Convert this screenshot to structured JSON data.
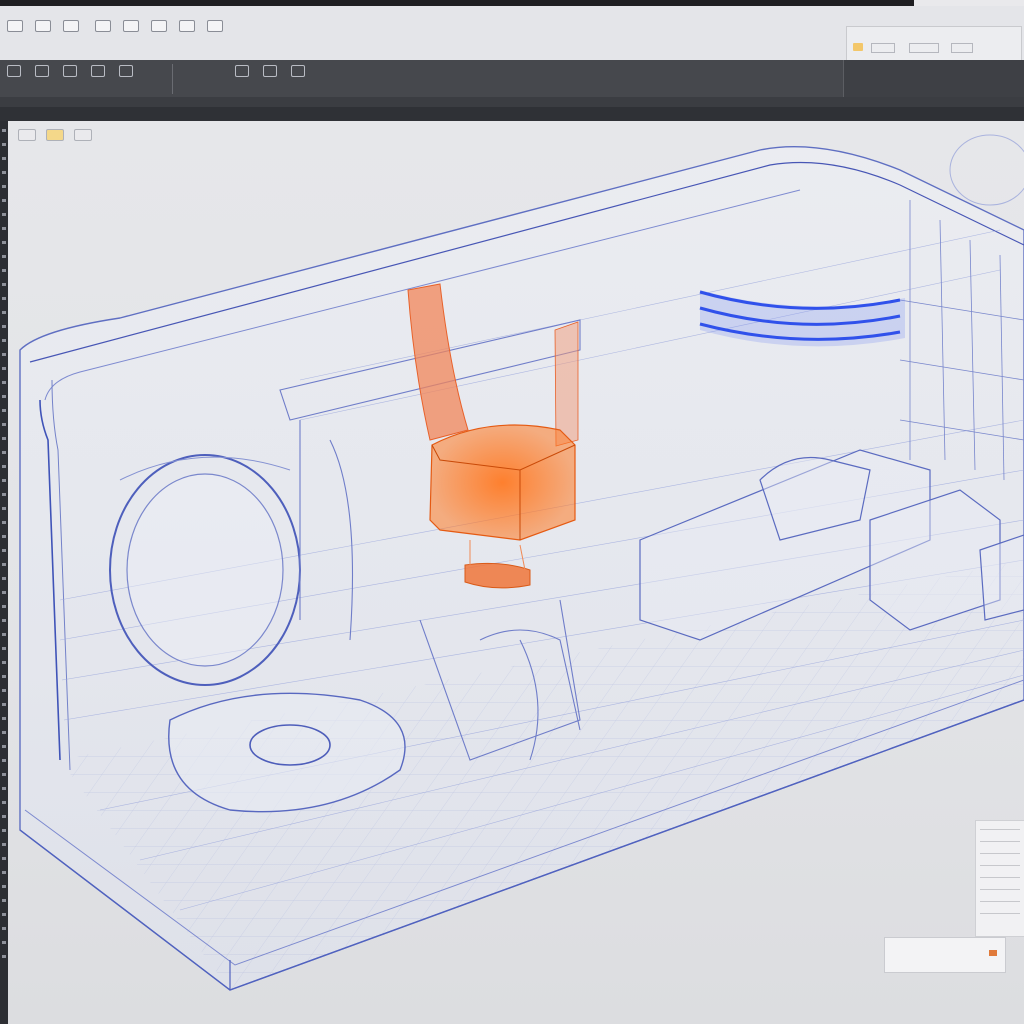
{
  "window": {
    "app_title": "",
    "quick_access": {
      "items": [
        "",
        "",
        "",
        "",
        "",
        "",
        "",
        ""
      ],
      "right_panel": {
        "label_a": "",
        "label_b": "",
        "label_c": ""
      }
    },
    "ribbon": {
      "left_texts": [
        "",
        ""
      ],
      "right_text": "",
      "buttons": [
        "",
        "",
        "",
        "",
        "",
        "",
        "",
        ""
      ]
    },
    "tabs": [
      "",
      "",
      "",
      "",
      "",
      "",
      "",
      "",
      ""
    ],
    "status_row": {
      "left": "",
      "middle": ""
    }
  },
  "viewport": {
    "mini_toolbar": [
      "",
      ""
    ],
    "colors": {
      "wireframe": "#3f53b8",
      "highlight_orange": "#f06a1d",
      "highlight_blue": "#1b3fe8",
      "background": "#e4e5e8"
    },
    "bottom_label": {
      "text": ""
    }
  }
}
